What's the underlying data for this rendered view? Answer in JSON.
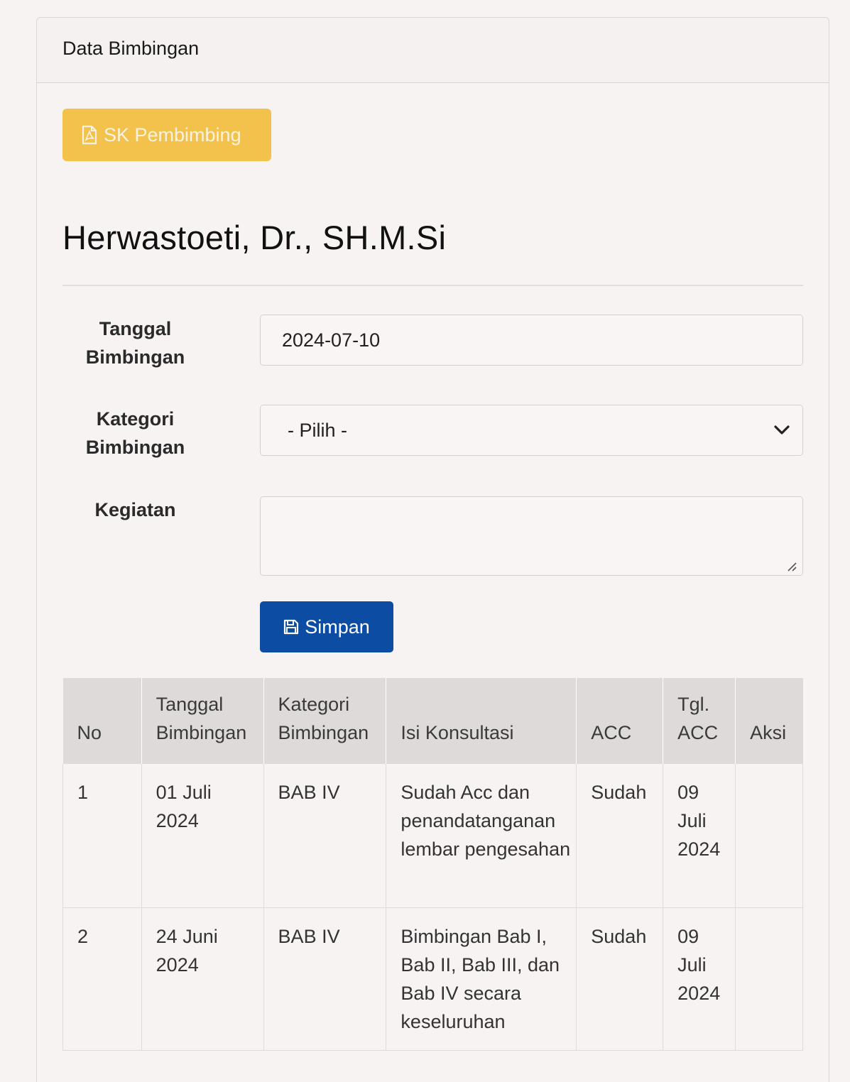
{
  "card": {
    "title": "Data Bimbingan"
  },
  "buttons": {
    "sk_pembimbing": "SK Pembimbing",
    "simpan": "Simpan"
  },
  "lecturer": {
    "name": "Herwastoeti, Dr., SH.M.Si"
  },
  "form": {
    "tanggal_label": "Tanggal Bimbingan",
    "tanggal_value": "2024-07-10",
    "kategori_label": "Kategori Bimbingan",
    "kategori_selected": "- Pilih -",
    "kegiatan_label": "Kegiatan",
    "kegiatan_value": ""
  },
  "table": {
    "headers": {
      "no": "No",
      "tanggal": "Tanggal Bimbingan",
      "kategori": "Kategori Bimbingan",
      "isi": "Isi Konsultasi",
      "acc": "ACC",
      "tgl_acc": "Tgl. ACC",
      "aksi": "Aksi"
    },
    "rows": [
      {
        "no": "1",
        "tanggal": "01 Juli 2024",
        "kategori": "BAB IV",
        "isi": "Sudah Acc dan penandatanganan lembar pengesahan",
        "acc": "Sudah",
        "tgl_acc": "09 Juli 2024",
        "aksi": ""
      },
      {
        "no": "2",
        "tanggal": "24 Juni 2024",
        "kategori": "BAB IV",
        "isi": "Bimbingan Bab I, Bab II, Bab III, dan Bab IV secara keseluruhan",
        "acc": "Sudah",
        "tgl_acc": "09 Juli 2024",
        "aksi": ""
      }
    ]
  },
  "colors": {
    "warning_button": "#f2c24c",
    "primary_button": "#0c4ca3",
    "table_header_bg": "#dedada",
    "page_bg": "#f8f3f3"
  },
  "icons": {
    "sk_pembimbing": "file-pdf-icon",
    "simpan": "save-icon",
    "select": "chevron-down-icon"
  }
}
